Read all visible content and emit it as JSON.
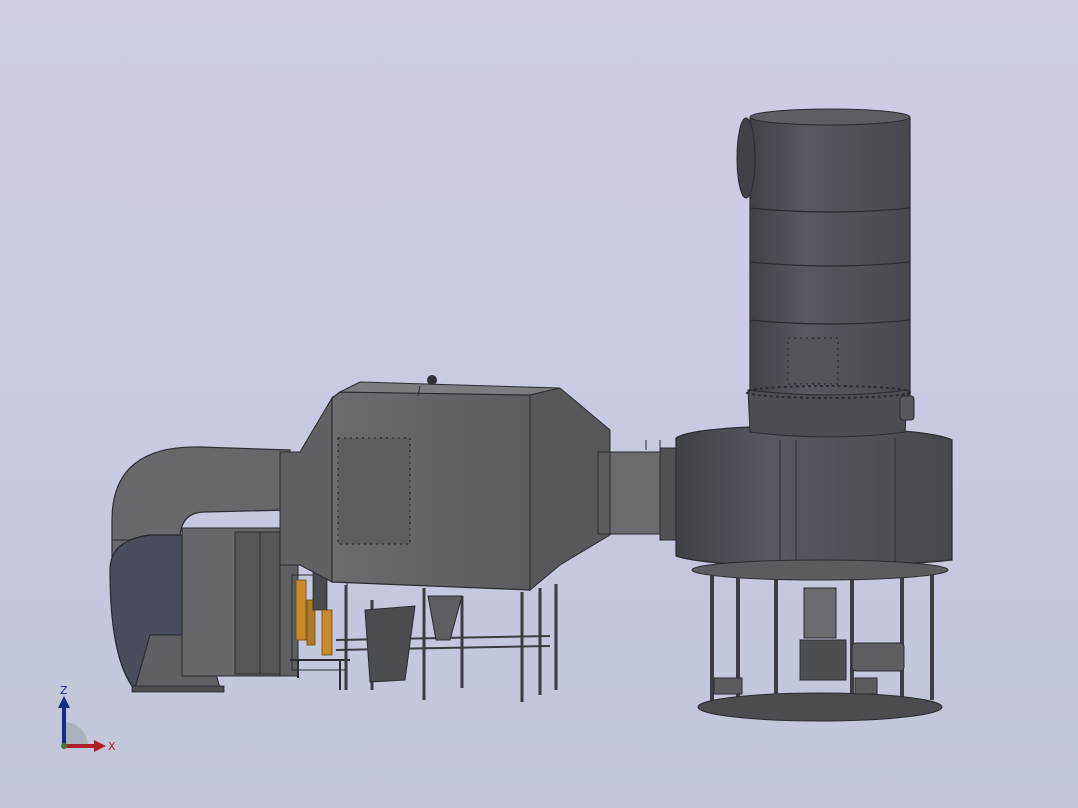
{
  "viewport": {
    "background_top": "#cdcde6",
    "background_bottom": "#c2c6d8"
  },
  "model": {
    "body_color": "#4f5257",
    "edge_color": "#2a2c30",
    "accent_color": "#c98a2a"
  },
  "triad": {
    "z_label": "Z",
    "x_label": "X",
    "z_color": "#1a2a8a",
    "x_color": "#b0202a"
  }
}
